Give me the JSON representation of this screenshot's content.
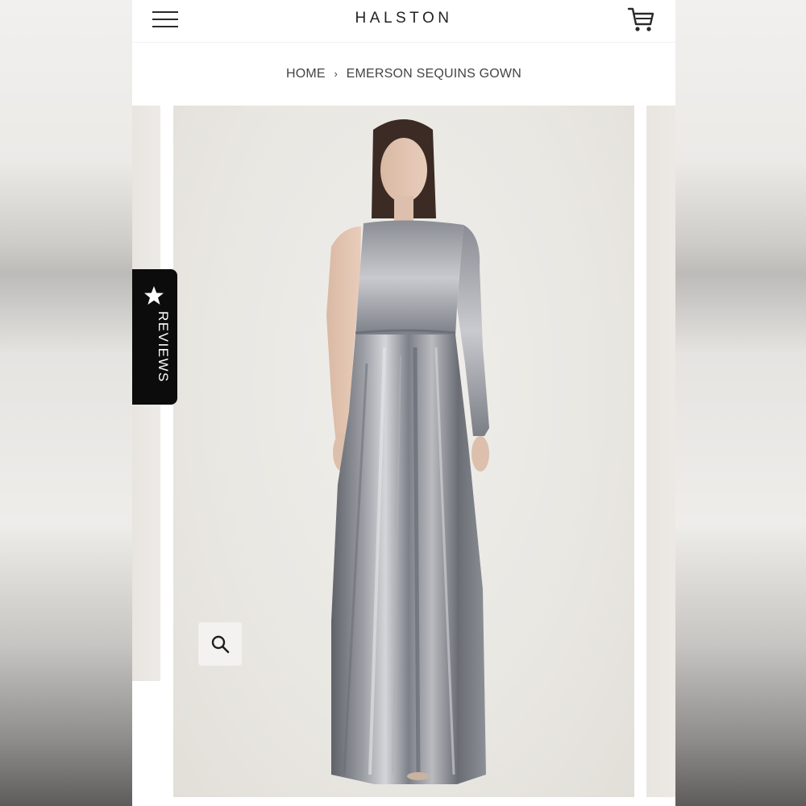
{
  "header": {
    "brand": "HALSTON",
    "menu_icon": "hamburger-menu-icon",
    "cart_icon": "shopping-cart-icon"
  },
  "breadcrumb": {
    "home": "HOME",
    "separator": "›",
    "current": "EMERSON SEQUINS GOWN"
  },
  "reviews_tab": {
    "label": "REVIEWS",
    "icon": "star-icon"
  },
  "gallery": {
    "zoom_icon": "magnifier-icon",
    "image_alt": "Model wearing a silver one-shoulder sequin gown"
  },
  "colors": {
    "text": "#222222",
    "reviews_tab_bg": "#0c0c0c",
    "page_bg": "#ffffff"
  }
}
